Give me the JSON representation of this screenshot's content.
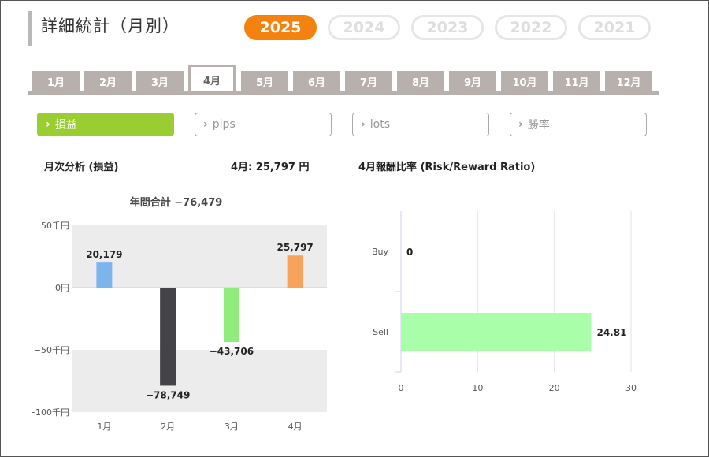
{
  "header": {
    "title": "詳細統計（月別）"
  },
  "years": [
    {
      "label": "2025",
      "active": true
    },
    {
      "label": "2024",
      "active": false
    },
    {
      "label": "2023",
      "active": false
    },
    {
      "label": "2022",
      "active": false
    },
    {
      "label": "2021",
      "active": false
    }
  ],
  "months": [
    {
      "label": "1月"
    },
    {
      "label": "2月"
    },
    {
      "label": "3月"
    },
    {
      "label": "4月",
      "active": true
    },
    {
      "label": "5月"
    },
    {
      "label": "6月"
    },
    {
      "label": "7月"
    },
    {
      "label": "8月"
    },
    {
      "label": "9月"
    },
    {
      "label": "10月"
    },
    {
      "label": "11月"
    },
    {
      "label": "12月"
    }
  ],
  "filters": [
    {
      "label": "損益",
      "active": true
    },
    {
      "label": "pips",
      "active": false
    },
    {
      "label": "lots",
      "active": false
    },
    {
      "label": "勝率",
      "active": false
    }
  ],
  "colors": {
    "accent": "#f5820f",
    "filter_active": "#9acd32",
    "tab": "#b8b0ad"
  },
  "left_panel": {
    "heading": "月次分析 (損益)",
    "month_summary": "4月:  25,797 円",
    "annual_total": "年間合計 −76,479"
  },
  "right_panel": {
    "heading": "4月報酬比率 (Risk/Reward Ratio)"
  },
  "chart_data": [
    {
      "type": "bar",
      "title": "年間合計 −76,479",
      "categories": [
        "1月",
        "2月",
        "3月",
        "4月"
      ],
      "values": [
        20179,
        -78749,
        -43706,
        25797
      ],
      "value_labels": [
        "20,179",
        "−78,749",
        "−43,706",
        "25,797"
      ],
      "bar_colors": [
        "#7cb5ec",
        "#434348",
        "#90ed7d",
        "#f7a35c"
      ],
      "ylim": [
        -100000,
        50000
      ],
      "yticks": [
        50000,
        0,
        -50000,
        -100000
      ],
      "ytick_labels": [
        "50千円",
        "0円",
        "−50千円",
        "−100千円"
      ],
      "xlabel": "",
      "ylabel": "",
      "grid": "alternating bands"
    },
    {
      "type": "bar",
      "orientation": "horizontal",
      "categories": [
        "Buy",
        "Sell"
      ],
      "values": [
        0,
        24.81
      ],
      "value_labels": [
        "0",
        "24.81"
      ],
      "bar_color": "#a9ffa9",
      "xlim": [
        0,
        30
      ],
      "xticks": [
        0,
        10,
        20,
        30
      ],
      "grid": true
    }
  ]
}
